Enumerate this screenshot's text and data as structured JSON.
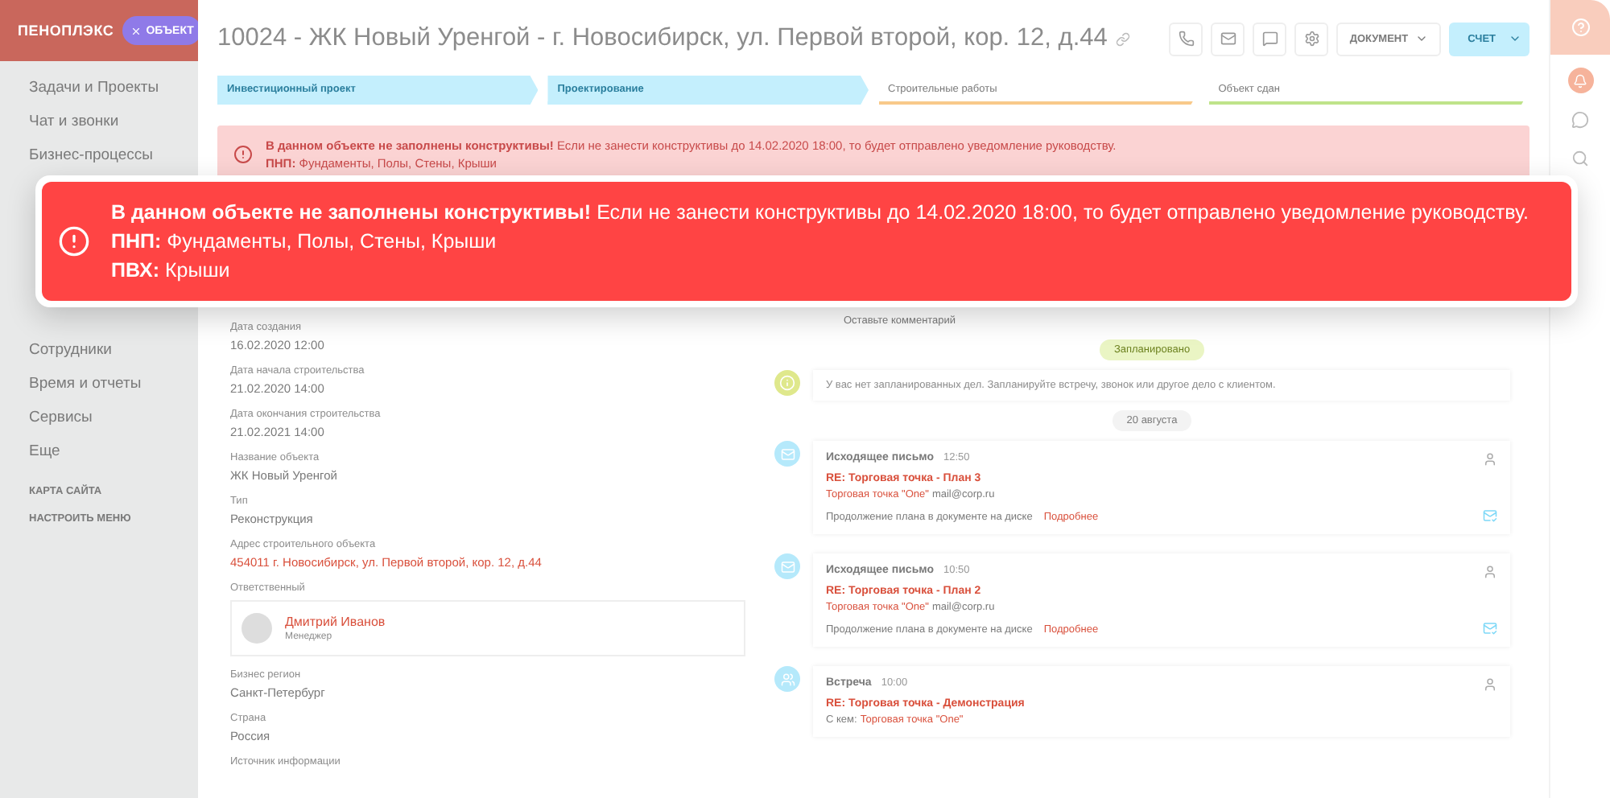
{
  "sidebar": {
    "logo": "ПЕНОПЛЭКС",
    "chip": "ОБЪЕКТ",
    "items": [
      "Задачи и Проекты",
      "Чат и звонки",
      "Бизнес-процессы"
    ],
    "more_items": [
      "Сотрудники",
      "Время и отчеты",
      "Сервисы",
      "Еще"
    ],
    "links": [
      "КАРТА САЙТА",
      "НАСТРОИТЬ МЕНЮ"
    ]
  },
  "header": {
    "title": "10024 - ЖК Новый Уренгой - г. Новосибирск, ул. Первой второй, кор. 12, д.44",
    "document_button": "ДОКУМЕНТ",
    "invoice_button": "СЧЕТ"
  },
  "stages": [
    {
      "label": "Инвестиционный проект",
      "done": true,
      "color": "#c4effd"
    },
    {
      "label": "Проектирование",
      "done": true,
      "color": "#c4effd"
    },
    {
      "label": "Строительные работы",
      "done": false,
      "color": "#f8c98a"
    },
    {
      "label": "Объект сдан",
      "done": false,
      "color": "#bfe38a"
    }
  ],
  "warning_banner": {
    "lines": [
      "**В данном объекте не заполнены конструктивы!** Если не занести конструктивы до 14.02.2020 18:00, то будет отправлено уведомление руководству.",
      "**ПНП:** Фундаменты, Полы, Стены, Крыши"
    ]
  },
  "fields": [
    {
      "label": "Дата создания",
      "value": "16.02.2020 12:00",
      "kind": "text"
    },
    {
      "label": "Дата начала строительства",
      "value": "21.02.2020 14:00",
      "kind": "text"
    },
    {
      "label": "Дата окончания строительства",
      "value": "21.02.2021 14:00",
      "kind": "text"
    },
    {
      "label": "Название объекта",
      "value": "ЖК Новый Уренгой",
      "kind": "text"
    },
    {
      "label": "Тип",
      "value": "Реконструкция",
      "kind": "text"
    },
    {
      "label": "Адрес строительного объекта",
      "value": "454011 г. Новосибирск, ул. Первой второй, кор. 12, д.44",
      "kind": "link"
    },
    {
      "label": "Ответственный",
      "value": "Дмитрий Иванов",
      "role": "Менеджер",
      "kind": "person"
    },
    {
      "label": "Бизнес регион",
      "value": "Санкт-Петербург",
      "kind": "text"
    },
    {
      "label": "Страна",
      "value": "Россия",
      "kind": "text"
    },
    {
      "label": "Источник информации",
      "kind": "text"
    }
  ],
  "comment": {
    "placeholder": "Оставьте комментарий"
  },
  "planned_badge": "Запланировано",
  "planned_info": "У вас нет запланированных дел. Запланируйте встречу, звонок или другое дело с клиентом.",
  "date_badge": "20 августа",
  "activities": [
    {
      "kind": "email",
      "title": "Исходящее письмо",
      "time": "12:50",
      "subject": "RE: Торговая точка - План 3",
      "from_name": "Торговая точка \"One\"",
      "from_email": "mail@corp.ru",
      "note": "Продолжение плана в документе на диске",
      "more": "Подробнее"
    },
    {
      "kind": "email",
      "title": "Исходящее письмо",
      "time": "10:50",
      "subject": "RE: Торговая точка - План 2",
      "from_name": "Торговая точка \"One\"",
      "from_email": "mail@corp.ru",
      "note": "Продолжение плана в документе на диске",
      "more": "Подробнее"
    },
    {
      "kind": "meeting",
      "title": "Встреча",
      "time": "10:00",
      "subject": "RE: Торговая точка - Демонстрация",
      "with_label": "С кем:",
      "with_name": "Торговая точка \"One\""
    }
  ],
  "alert": {
    "lines": [
      "**В данном объекте не заполнены конструктивы!** Если не занести конструктивы до 14.02.2020 18:00, то будет отправлено уведомление руководству.",
      "**ПНП:** Фундаменты, Полы, Стены, Крыши",
      "**ПВХ:** Крыши"
    ]
  }
}
